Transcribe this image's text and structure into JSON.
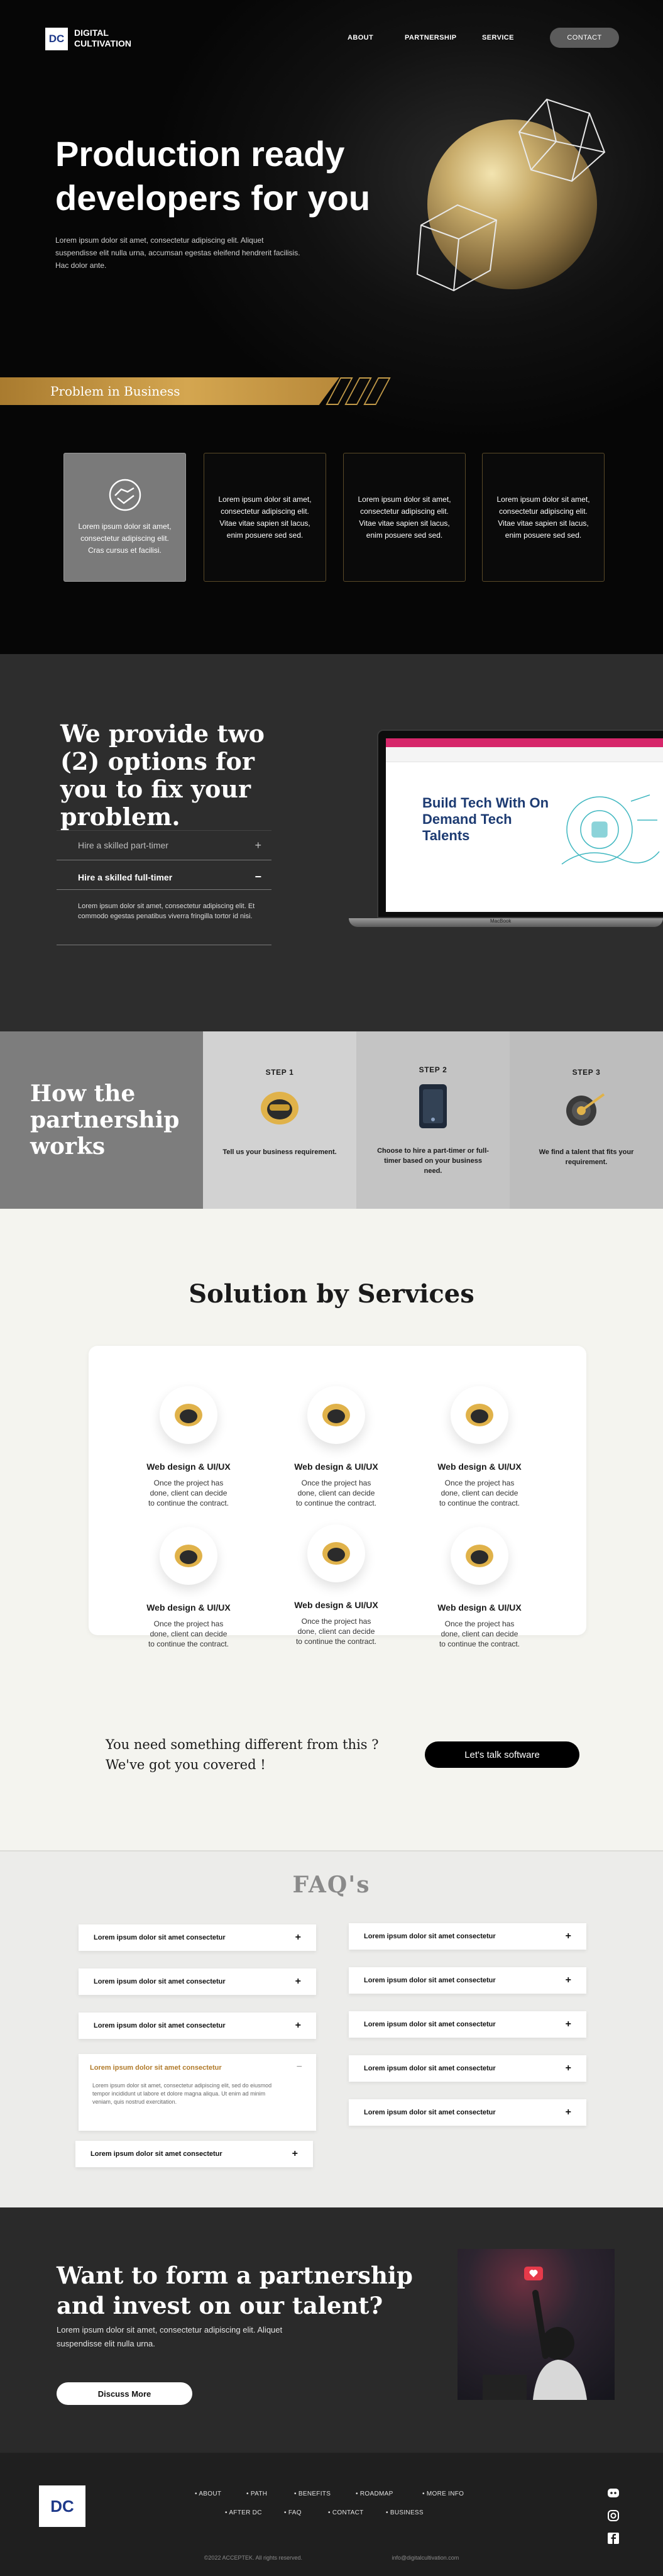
{
  "brand": {
    "mark": "DC",
    "name_line1": "DIGITAL",
    "name_line2": "CULTIVATION"
  },
  "nav": {
    "about": "ABOUT",
    "partnership": "PARTNERSHIP",
    "service": "SERVICE",
    "contact": "CONTACT"
  },
  "hero": {
    "title": "Production ready developers for you",
    "subtitle": "Lorem ipsum dolor sit amet, consectetur adipiscing elit. Aliquet suspendisse elit nulla urna, accumsan egestas eleifend hendrerit facilisis. Hac dolor ante."
  },
  "problem": {
    "label": "Problem in Business",
    "cards": [
      "Lorem ipsum dolor sit amet, consectetur adipiscing elit. Cras cursus et facilisi.",
      "Lorem ipsum dolor sit amet, consectetur adipiscing elit. Vitae vitae sapien sit lacus, enim posuere sed sed.",
      "Lorem ipsum dolor sit amet, consectetur adipiscing elit. Vitae vitae sapien sit lacus, enim posuere sed sed.",
      "Lorem ipsum dolor sit amet, consectetur adipiscing elit. Vitae vitae sapien sit lacus, enim posuere sed sed."
    ]
  },
  "options": {
    "title": "We provide two (2) options for you to fix your problem.",
    "item1": "Hire a skilled part-timer",
    "item2": "Hire a skilled full-timer",
    "item2_body": "Lorem ipsum dolor sit amet, consectetur adipiscing elit. Et commodo egestas penatibus viverra fringilla tortor id nisi.",
    "plus": "+",
    "minus": "−",
    "laptop": {
      "headline": "Build Tech With On Demand Tech Talents",
      "base_label": "MacBook"
    }
  },
  "how": {
    "title": "How the partnership works",
    "steps": [
      {
        "label": "STEP 1",
        "text": "Tell us your business requirement."
      },
      {
        "label": "STEP 2",
        "text": "Choose to hire a part-timer or full-timer based on your business need."
      },
      {
        "label": "STEP 3",
        "text": "We find a talent that fits your requirement."
      }
    ]
  },
  "solution": {
    "title": "Solution by Services",
    "services": [
      {
        "title": "Web design & UI/UX",
        "text": "Once the project has done, client can decide to continue the contract."
      },
      {
        "title": "Web design & UI/UX",
        "text": "Once the project has done, client can decide to continue the contract."
      },
      {
        "title": "Web design & UI/UX",
        "text": "Once the project has done, client can decide to continue the contract."
      },
      {
        "title": "Web design & UI/UX",
        "text": "Once the project has done, client can decide to continue the contract."
      },
      {
        "title": "Web design & UI/UX",
        "text": "Once the project has done, client can decide to continue the contract."
      },
      {
        "title": "Web design & UI/UX",
        "text": "Once the project has done, client can decide to continue the contract."
      }
    ],
    "cta_line1": "You need something different from this ?",
    "cta_line2": "We've got you covered !",
    "cta_button": "Let's talk software"
  },
  "faq": {
    "title": "FAQ's",
    "question": "Lorem ipsum dolor sit amet consectetur",
    "open_question": "Lorem ipsum dolor sit amet consectetur",
    "open_answer": "Lorem ipsum dolor sit amet, consectetur adipiscing elit, sed do eiusmod tempor incididunt ut labore et dolore magna aliqua. Ut enim ad minim veniam, quis nostrud exercitation.",
    "plus": "+",
    "minus": "−"
  },
  "partner": {
    "title": "Want to form a partnership and invest on our talent?",
    "subtitle": "Lorem ipsum dolor sit amet, consectetur adipiscing elit. Aliquet suspendisse elit nulla urna.",
    "button": "Discuss More"
  },
  "footer": {
    "links": [
      "• ABOUT",
      "• PATH",
      "• BENEFITS",
      "• ROADMAP",
      "• MORE INFO",
      "• AFTER DC",
      "• FAQ",
      "• CONTACT",
      "• BUSINESS"
    ],
    "copyright": "©2022 ACCEPTEK. All rights reserved.",
    "email": "info@digitalcultivation.com"
  },
  "colors": {
    "gold": "#c9a24e",
    "dark": "#0b0b0b",
    "navy": "#1d3b72"
  }
}
